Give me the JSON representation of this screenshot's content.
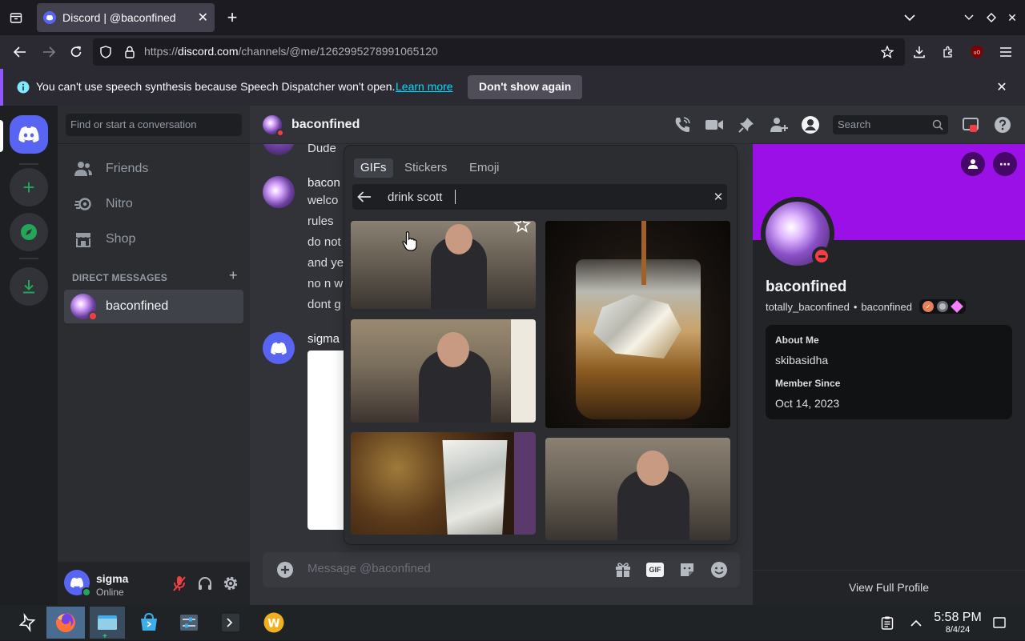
{
  "browser": {
    "tab_title": "Discord | @baconfined",
    "url_prefix": "https://",
    "url_domain": "discord.com",
    "url_path": "/channels/@me/1262995278991065120"
  },
  "notification": {
    "message": "You can't use speech synthesis because Speech Dispatcher won't open.",
    "learn_more": "Learn more",
    "dont_show": "Don't show again"
  },
  "sidebar": {
    "search_placeholder": "Find or start a conversation",
    "nav": [
      {
        "label": "Friends"
      },
      {
        "label": "Nitro"
      },
      {
        "label": "Shop"
      }
    ],
    "dm_header": "DIRECT MESSAGES",
    "dm_items": [
      {
        "label": "baconfined"
      }
    ]
  },
  "user_panel": {
    "name": "sigma",
    "status": "Online"
  },
  "chat_header": {
    "name": "baconfined",
    "search_placeholder": "Search"
  },
  "messages": {
    "top_line": "Dude",
    "group1_author": "bacon",
    "group1_lines": [
      "welco",
      "rules",
      "do not",
      "and ye",
      "no n w",
      "dont g"
    ],
    "group2_author": "sigma"
  },
  "composer": {
    "placeholder": "Message @baconfined"
  },
  "gif_picker": {
    "tabs": [
      "GIFs",
      "Stickers",
      "Emoji"
    ],
    "search_value": "drink scott"
  },
  "profile": {
    "display_name": "baconfined",
    "username": "totally_baconfined",
    "separator": "•",
    "pronoun": "baconfined",
    "about_label": "About Me",
    "about_value": "skibasidha",
    "member_label": "Member Since",
    "member_value": "Oct 14, 2023",
    "view_full": "View Full Profile",
    "banner_color": "#9b10e6"
  },
  "taskbar": {
    "time": "5:58 PM",
    "date": "8/4/24"
  },
  "colors": {
    "accent": "#5865f2",
    "green": "#23a55a",
    "dnd": "#f23f43"
  }
}
